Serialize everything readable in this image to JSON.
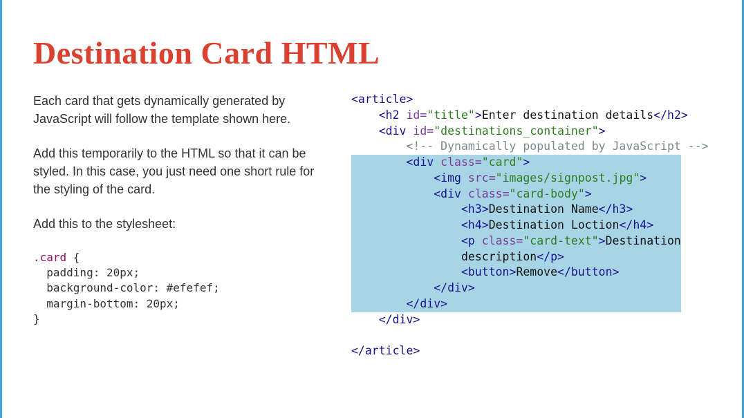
{
  "heading": "Destination Card HTML",
  "left": {
    "p1": "Each card that gets dynamically generated by JavaScript will follow the template shown here.",
    "p2": "Add this temporarily to the HTML so that it can be styled. In this case, you just need one short rule for the styling of the card.",
    "p3": "Add this to the stylesheet:",
    "css": {
      "selector": ".card",
      "open": " {",
      "l1": "  padding: 20px;",
      "l2": "  background-color: #efefef;",
      "l3": "  margin-bottom: 20px;",
      "close": "}"
    }
  },
  "code": {
    "article_open": "<article>",
    "h2_open": "<h2",
    "h2_id_attr": " id=",
    "h2_id_val": "\"title\"",
    "h2_close_tag": ">",
    "h2_text": "Enter destination details",
    "h2_end": "</h2>",
    "div1_open": "<div",
    "div1_id_attr": " id=",
    "div1_id_val": "\"destinations_container\"",
    "div1_close_tag": ">",
    "comment": "<!-- Dynamically populated by JavaScript -->",
    "card_open": "<div",
    "card_class_attr": " class=",
    "card_class_val": "\"card\"",
    "card_close_tag": ">",
    "img_open": "<img",
    "img_src_attr": " src=",
    "img_src_val": "\"images/signpost.jpg\"",
    "img_close": ">",
    "body_open": "<div",
    "body_class_attr": " class=",
    "body_class_val": "\"card-body\"",
    "body_close_tag": ">",
    "h3_open": "<h3>",
    "h3_text": "Destination Name",
    "h3_end": "</h3>",
    "h4_open": "<h4>",
    "h4_text": "Destination Loction",
    "h4_end": "</h4>",
    "p_open": "<p",
    "p_class_attr": " class=",
    "p_class_val": "\"card-text\"",
    "p_close_tag": ">",
    "p_text1": "Destination",
    "p_text2": "description",
    "p_end": "</p>",
    "btn_open": "<button>",
    "btn_text": "Remove",
    "btn_end": "</button>",
    "body_end": "</div>",
    "card_end": "</div>",
    "div1_end": "</div>",
    "article_end": "</article>"
  }
}
